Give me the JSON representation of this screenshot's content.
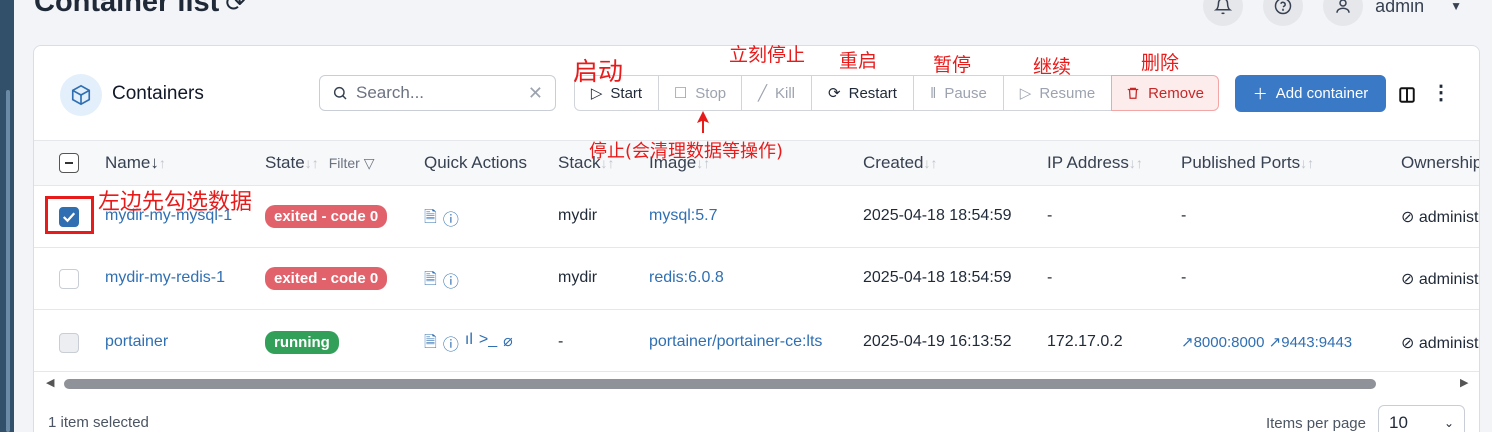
{
  "page": {
    "title": "Container list"
  },
  "user": {
    "name": "admin"
  },
  "card": {
    "title": "Containers"
  },
  "search": {
    "placeholder": "Search..."
  },
  "toolbar": {
    "start": "Start",
    "stop": "Stop",
    "kill": "Kill",
    "restart": "Restart",
    "pause": "Pause",
    "resume": "Resume",
    "remove": "Remove",
    "add": "Add container"
  },
  "columns": {
    "name": "Name",
    "state": "State",
    "filter": "Filter",
    "quick_actions": "Quick Actions",
    "stack": "Stack",
    "image": "Image",
    "created": "Created",
    "ip": "IP Address",
    "ports": "Published Ports",
    "ownership": "Ownership"
  },
  "rows": [
    {
      "name": "mydir-my-mysql-1",
      "state": "exited - code 0",
      "stack": "mydir",
      "image": "mysql:5.7",
      "created": "2025-04-18 18:54:59",
      "ip": "-",
      "ports": "-",
      "ownership": "administrators",
      "selected": true
    },
    {
      "name": "mydir-my-redis-1",
      "state": "exited - code 0",
      "stack": "mydir",
      "image": "redis:6.0.8",
      "created": "2025-04-18 18:54:59",
      "ip": "-",
      "ports": "-",
      "ownership": "administrators",
      "selected": false
    },
    {
      "name": "portainer",
      "state": "running",
      "stack": "-",
      "image": "portainer/portainer-ce:lts",
      "created": "2025-04-19 16:13:52",
      "ip": "172.17.0.2",
      "port1": "8000:8000",
      "port2": "9443:9443",
      "ownership": "administrators",
      "selected": false
    }
  ],
  "footer": {
    "selected": "1 item selected",
    "items_per_page_label": "Items per page",
    "items_per_page": "10"
  },
  "annotations": {
    "start": "启动",
    "kill": "立刻停止",
    "restart": "重启",
    "pause": "暂停",
    "resume": "继续",
    "remove": "删除",
    "stop": "停止(会清理数据等操作)",
    "select": "左边先勾选数据"
  },
  "colors": {
    "primary": "#3979c6",
    "danger": "#e2626b",
    "success": "#33a05a",
    "annotation": "#e81b1b"
  }
}
